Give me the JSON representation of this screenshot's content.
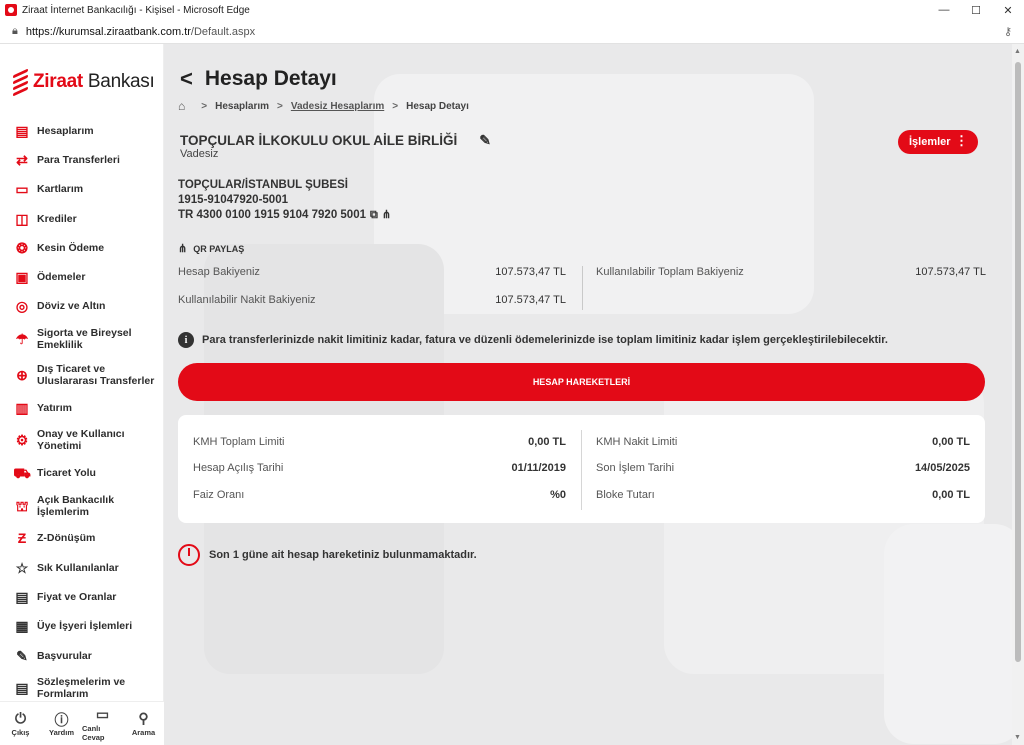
{
  "window": {
    "title": "Ziraat İnternet Bankacılığı - Kişisel - Microsoft Edge",
    "url_domain": "https://kurumsal.ziraatbank.com.tr",
    "url_path": "/Default.aspx",
    "minimize": "—",
    "maximize": "☐",
    "close": "✕"
  },
  "brand": {
    "name_bold": "Ziraat",
    "name_rest": " Bankası",
    "color": "#e30a17"
  },
  "sidebar": {
    "items": [
      {
        "label": "Hesaplarım",
        "icon": "book-icon"
      },
      {
        "label": "Para Transferleri",
        "icon": "transfer-icon"
      },
      {
        "label": "Kartlarım",
        "icon": "card-icon"
      },
      {
        "label": "Krediler",
        "icon": "loan-icon"
      },
      {
        "label": "Kesin Ödeme",
        "icon": "payment-icon"
      },
      {
        "label": "Ödemeler",
        "icon": "bill-icon"
      },
      {
        "label": "Döviz ve Altın",
        "icon": "currency-icon"
      },
      {
        "label": "Sigorta ve Bireysel Emeklilik",
        "icon": "umbrella-icon"
      },
      {
        "label": "Dış Ticaret ve Uluslararası Transferler",
        "icon": "globe-icon"
      },
      {
        "label": "Yatırım",
        "icon": "chart-icon"
      },
      {
        "label": "Onay ve Kullanıcı Yönetimi",
        "icon": "gear-icon"
      },
      {
        "label": "Ticaret Yolu",
        "icon": "cart-icon"
      },
      {
        "label": "Açık Bankacılık İşlemlerim",
        "icon": "bank-icon"
      },
      {
        "label": "Z-Dönüşüm",
        "icon": "z-icon"
      },
      {
        "label": "Sık Kullanılanlar",
        "icon": "star-icon"
      },
      {
        "label": "Fiyat ve Oranlar",
        "icon": "document-icon"
      },
      {
        "label": "Üye İşyeri İşlemleri",
        "icon": "building-icon"
      },
      {
        "label": "Başvurular",
        "icon": "edit-icon"
      },
      {
        "label": "Sözleşmelerim ve Formlarım",
        "icon": "contract-icon"
      }
    ],
    "footer": [
      {
        "label": "Çıkış",
        "icon": "power-icon"
      },
      {
        "label": "Yardım",
        "icon": "help-icon"
      },
      {
        "label": "Canlı Cevap",
        "icon": "chat-icon"
      },
      {
        "label": "Arama",
        "icon": "search-icon"
      }
    ]
  },
  "page": {
    "title": "Hesap Detayı",
    "breadcrumb": [
      "Hesaplarım",
      "Vadesiz Hesaplarım",
      "Hesap Detayı"
    ],
    "account_name": "TOPÇULAR İLKOKULU OKUL AİLE BİRLİĞİ",
    "account_type": "Vadesiz",
    "actions_button": "İşlemler",
    "branch": "TOPÇULAR/İSTANBUL ŞUBESİ",
    "account_no": "1915-91047920-5001",
    "iban": "TR 4300 0100 1915 9104 7920 5001",
    "qr_share": "QR PAYLAŞ",
    "balances": {
      "hesap_bakiye_label": "Hesap Bakiyeniz",
      "hesap_bakiye_value": "107.573,47 TL",
      "nakit_label": "Kullanılabilir Nakit Bakiyeniz",
      "nakit_value": "107.573,47 TL",
      "toplam_label": "Kullanılabilir Toplam Bakiyeniz",
      "toplam_value": "107.573,47 TL"
    },
    "info_text": "Para transferlerinizde nakit limitiniz kadar, fatura ve düzenli ödemelerinizde ise toplam limitiniz kadar işlem gerçekleştirilebilecektir.",
    "movements_button": "HESAP HAREKETLERİ",
    "details": {
      "kmh_toplam_label": "KMH Toplam Limiti",
      "kmh_toplam_value": "0,00 TL",
      "acilis_label": "Hesap Açılış Tarihi",
      "acilis_value": "01/11/2019",
      "faiz_label": "Faiz Oranı",
      "faiz_value": "%0",
      "kmh_nakit_label": "KMH Nakit Limiti",
      "kmh_nakit_value": "0,00 TL",
      "son_islem_label": "Son İşlem Tarihi",
      "son_islem_value": "14/05/2025",
      "bloke_label": "Bloke Tutarı",
      "bloke_value": "0,00 TL"
    },
    "no_movement_text": "Son 1 güne ait hesap hareketiniz bulunmamaktadır."
  }
}
